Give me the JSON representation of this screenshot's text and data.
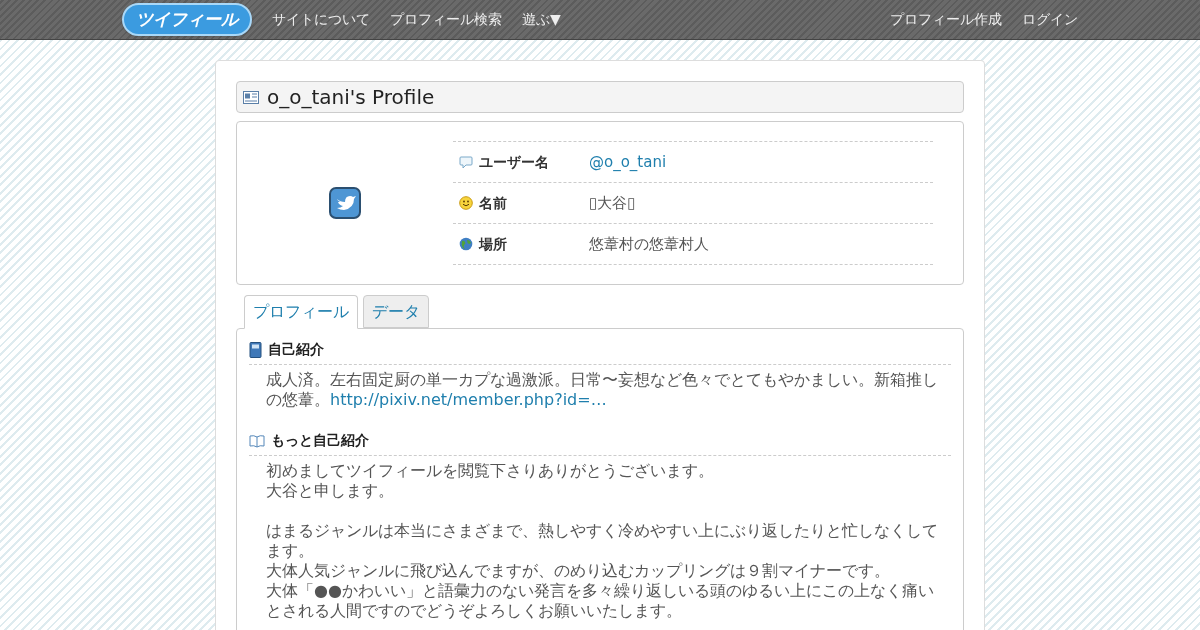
{
  "header": {
    "logo": "ツイフィール",
    "nav_left": [
      "サイトについて",
      "プロフィール検索",
      "遊ぶ▼"
    ],
    "nav_right": [
      "プロフィール作成",
      "ログイン"
    ]
  },
  "title": "o_o_tani's Profile",
  "fields": [
    {
      "kind": "speech",
      "label": "ユーザー名",
      "value": "@o_o_tani",
      "link": true
    },
    {
      "kind": "smile",
      "label": "名前",
      "value": "▯大谷▯",
      "link": false
    },
    {
      "kind": "globe",
      "label": "場所",
      "value": "悠葦村の悠葦村人",
      "link": false
    }
  ],
  "tabs": [
    {
      "label": "プロフィール",
      "selected": true
    },
    {
      "label": "データ",
      "selected": false
    }
  ],
  "sections": [
    {
      "kind": "book",
      "heading": "自己紹介",
      "paragraphs": [
        {
          "text": "成人済。左右固定厨の単一カプな過激派。日常〜妄想など色々でとてもやかましい。新箱推しの悠葦。",
          "link": "http://pixiv.net/member.php?id=…"
        }
      ]
    },
    {
      "kind": "open-book",
      "heading": "もっと自己紹介",
      "paragraphs": [
        {
          "text": "初めましてツイフィールを閲覧下さりありがとうございます。"
        },
        {
          "text": "大谷と申します。",
          "space_after": true
        },
        {
          "text": "はまるジャンルは本当にさまざまで、熱しやすく冷めやすい上にぶり返したりと忙しなくしてます。"
        },
        {
          "text": "大体人気ジャンルに飛び込んでますが、のめり込むカップリングは９割マイナーです。"
        },
        {
          "text": "大体「●●かわいい」と語彙力のない発言を多々繰り返しいる頭のゆるい上にこの上なく痛いとされる人間ですのでどうぞよろしくお願いいたします。"
        }
      ]
    }
  ]
}
